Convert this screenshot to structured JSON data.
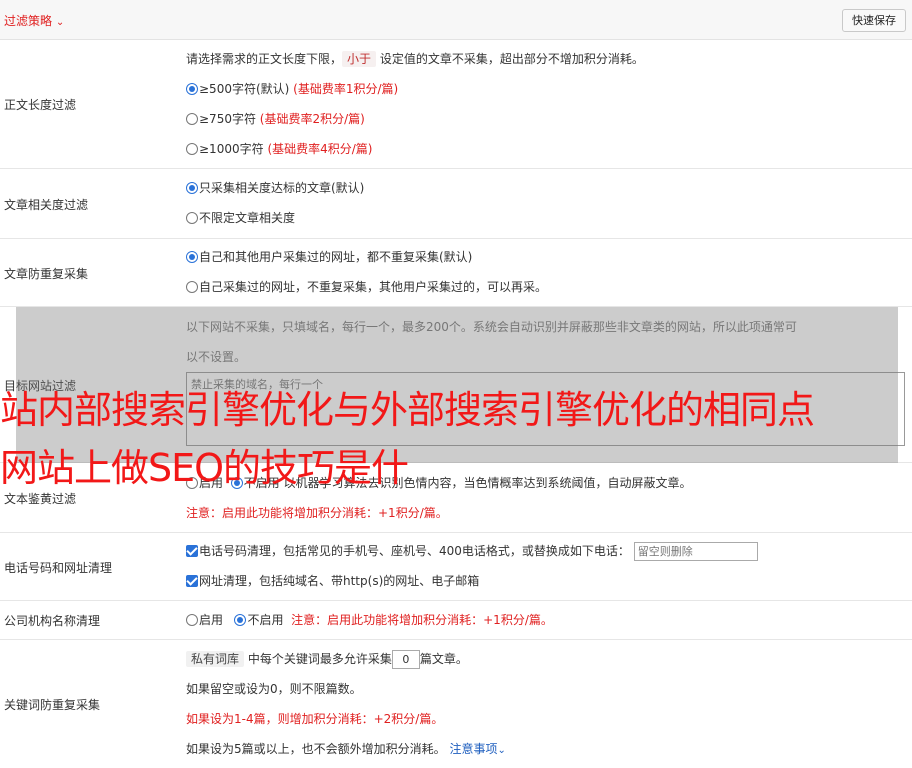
{
  "header": {
    "title": "过滤策略",
    "title_icon": "double-chevron-down-icon",
    "save_label": "快速保存"
  },
  "length_filter": {
    "label": "正文长度过滤",
    "desc_pre": "请选择需求的正文长度下限，",
    "desc_tag": "小于",
    "desc_post": "设定值的文章不采集，超出部分不增加积分消耗。",
    "options": [
      {
        "text": "≥500字符(默认)",
        "note": "(基础费率1积分/篇)"
      },
      {
        "text": "≥750字符",
        "note": "(基础费率2积分/篇)"
      },
      {
        "text": "≥1000字符",
        "note": "(基础费率4积分/篇)"
      }
    ]
  },
  "relevance_filter": {
    "label": "文章相关度过滤",
    "options": [
      "只采集相关度达标的文章(默认)",
      "不限定文章相关度"
    ]
  },
  "dedup": {
    "label": "文章防重复采集",
    "options": [
      "自己和其他用户采集过的网址，都不重复采集(默认)",
      "自己采集过的网址，不重复采集，其他用户采集过的，可以再采。"
    ]
  },
  "site_filter": {
    "label": "目标网站过滤",
    "desc_line1": "以下网站不采集，只填域名，每行一个，最多200个。系统会自动识别并屏蔽那些非文章类的网站，所以此项通常可",
    "desc_line2": "以不设置。",
    "placeholder": "禁止采集的域名，每行一个"
  },
  "porn_filter": {
    "label": "文本鉴黄过滤",
    "opt_on": "启用",
    "opt_off": "不启用",
    "desc": "以机器学习算法去识别色情内容，当色情概率达到系统阈值，自动屏蔽文章。",
    "note": "注意：启用此功能将增加积分消耗：+1积分/篇。"
  },
  "contact_clean": {
    "label": "电话号码和网址清理",
    "phone_text": "电话号码清理，包括常见的手机号、座机号、400电话格式，或替换成如下电话：",
    "phone_placeholder": "留空则删除",
    "url_text": "网址清理，包括纯域名、带http(s)的网址、电子邮箱"
  },
  "company_clean": {
    "label": "公司机构名称清理",
    "opt_on": "启用",
    "opt_off": "不启用",
    "note": "注意：启用此功能将增加积分消耗：+1积分/篇。"
  },
  "keyword_dedup": {
    "label": "关键词防重复采集",
    "tag": "私有词库",
    "line1_pre": "中每个关键词最多允许采集",
    "count": "0",
    "line1_post": "篇文章。",
    "line2": "如果留空或设为0，则不限篇数。",
    "line3": "如果设为1-4篇，则增加积分消耗：+2积分/篇。",
    "line4": "如果设为5篇或以上，也不会额外增加积分消耗。",
    "link": "注意事项"
  },
  "banner": {
    "line1": "站内部搜索引擎优化与外部搜索引擎优化的相同点",
    "line2": "网站上做SEO的技巧是什"
  },
  "colors": {
    "accent_red": "#e02020",
    "radio_blue": "#2a72d8",
    "link_blue": "#1f5fbf"
  }
}
